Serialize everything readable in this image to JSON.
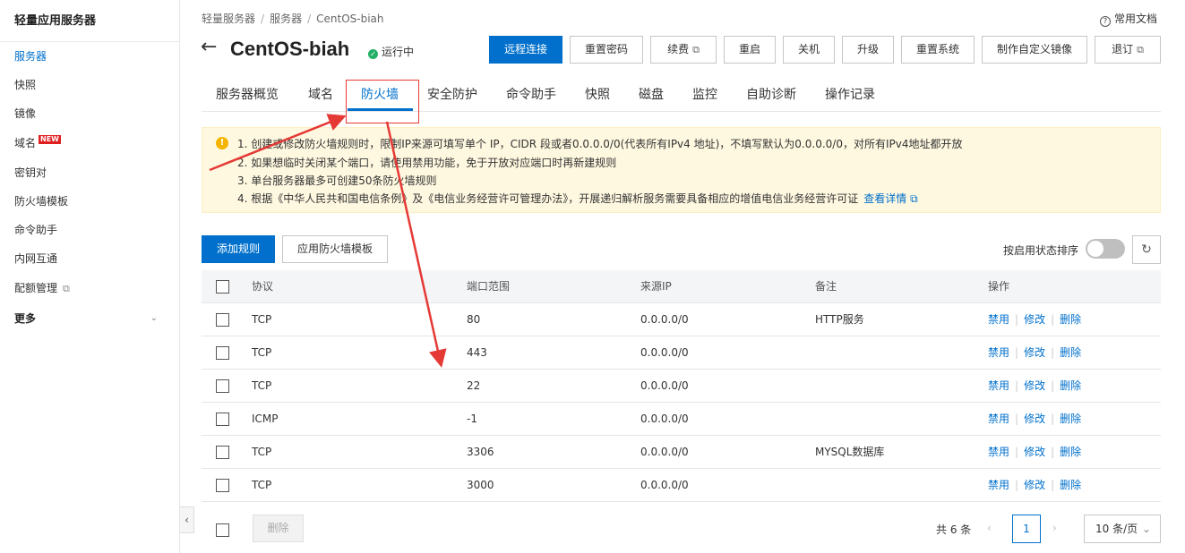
{
  "sidebar": {
    "title": "轻量应用服务器",
    "items": [
      {
        "label": "服务器",
        "active": true
      },
      {
        "label": "快照"
      },
      {
        "label": "镜像"
      },
      {
        "label": "域名",
        "badge": "NEW"
      },
      {
        "label": "密钥对"
      },
      {
        "label": "防火墙模板"
      },
      {
        "label": "命令助手"
      },
      {
        "label": "内网互通"
      },
      {
        "label": "配额管理",
        "icon": "external-link-icon"
      },
      {
        "label": "更多",
        "icon": "chevron-down-icon"
      }
    ],
    "collapse_glyph": "‹"
  },
  "breadcrumb": [
    "轻量服务器",
    "服务器",
    "CentOS-biah"
  ],
  "docs_label": "常用文档",
  "server": {
    "name": "CentOS-biah",
    "status": "运行中"
  },
  "actions": [
    {
      "label": "远程连接",
      "primary": true
    },
    {
      "label": "重置密码"
    },
    {
      "label": "续费",
      "external": true
    },
    {
      "label": "重启"
    },
    {
      "label": "关机"
    },
    {
      "label": "升级"
    },
    {
      "label": "重置系统"
    },
    {
      "label": "制作自定义镜像"
    },
    {
      "label": "退订",
      "external": true
    }
  ],
  "tabs": [
    {
      "label": "服务器概览"
    },
    {
      "label": "域名"
    },
    {
      "label": "防火墙",
      "active": true
    },
    {
      "label": "安全防护"
    },
    {
      "label": "命令助手"
    },
    {
      "label": "快照"
    },
    {
      "label": "磁盘"
    },
    {
      "label": "监控"
    },
    {
      "label": "自助诊断"
    },
    {
      "label": "操作记录"
    }
  ],
  "notice": {
    "lines": [
      "1. 创建或修改防火墙规则时，限制IP来源可填写单个 IP，CIDR 段或者0.0.0.0/0(代表所有IPv4 地址)，不填写默认为0.0.0.0/0，对所有IPv4地址都开放",
      "2. 如果想临时关闭某个端口，请使用禁用功能，免于开放对应端口时再新建规则",
      "3. 单台服务器最多可创建50条防火墙规则",
      "4. 根据《中华人民共和国电信条例》及《电信业务经营许可管理办法》，开展递归解析服务需要具备相应的增值电信业务经营许可证"
    ],
    "link": "查看详情"
  },
  "toolbar": {
    "add_rule": "添加规则",
    "apply_template": "应用防火墙模板",
    "sort_label": "按启用状态排序",
    "sort_enabled": false
  },
  "table": {
    "columns": [
      "协议",
      "端口范围",
      "来源IP",
      "备注",
      "操作"
    ],
    "rows": [
      {
        "protocol": "TCP",
        "port": "80",
        "source": "0.0.0.0/0",
        "note": "HTTP服务"
      },
      {
        "protocol": "TCP",
        "port": "443",
        "source": "0.0.0.0/0",
        "note": ""
      },
      {
        "protocol": "TCP",
        "port": "22",
        "source": "0.0.0.0/0",
        "note": ""
      },
      {
        "protocol": "ICMP",
        "port": "-1",
        "source": "0.0.0.0/0",
        "note": ""
      },
      {
        "protocol": "TCP",
        "port": "3306",
        "source": "0.0.0.0/0",
        "note": "MYSQL数据库"
      },
      {
        "protocol": "TCP",
        "port": "3000",
        "source": "0.0.0.0/0",
        "note": ""
      }
    ],
    "ops": [
      "禁用",
      "修改",
      "删除"
    ]
  },
  "footer": {
    "delete_label": "删除",
    "total": "共 6 条",
    "current_page": "1",
    "page_size": "10 条/页"
  },
  "colors": {
    "primary": "#0070cc",
    "annotation": "#e53935",
    "notice_bg": "#fff8e0"
  }
}
